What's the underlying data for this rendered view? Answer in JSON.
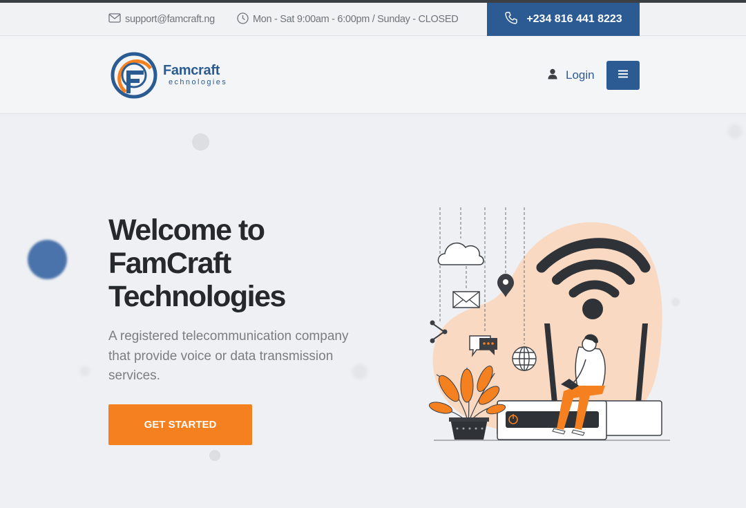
{
  "topbar": {
    "email": "support@famcraft.ng",
    "hours": "Mon - Sat 9:00am - 6:00pm / Sunday - CLOSED",
    "phone": "+234 816 441 8223"
  },
  "nav": {
    "brand_name": "Famcraft",
    "brand_tagline": "echnologies",
    "login_label": "Login"
  },
  "hero": {
    "title_line1": "Welcome to",
    "title_line2": "FamCraft",
    "title_line3": "Technologies",
    "subtitle": "A registered telecommunication company that provide voice or data transmission services.",
    "cta_label": "GET STARTED"
  },
  "colors": {
    "brand_blue": "#2c5a93",
    "accent_orange": "#f48020",
    "peach": "#f9d9c2"
  }
}
